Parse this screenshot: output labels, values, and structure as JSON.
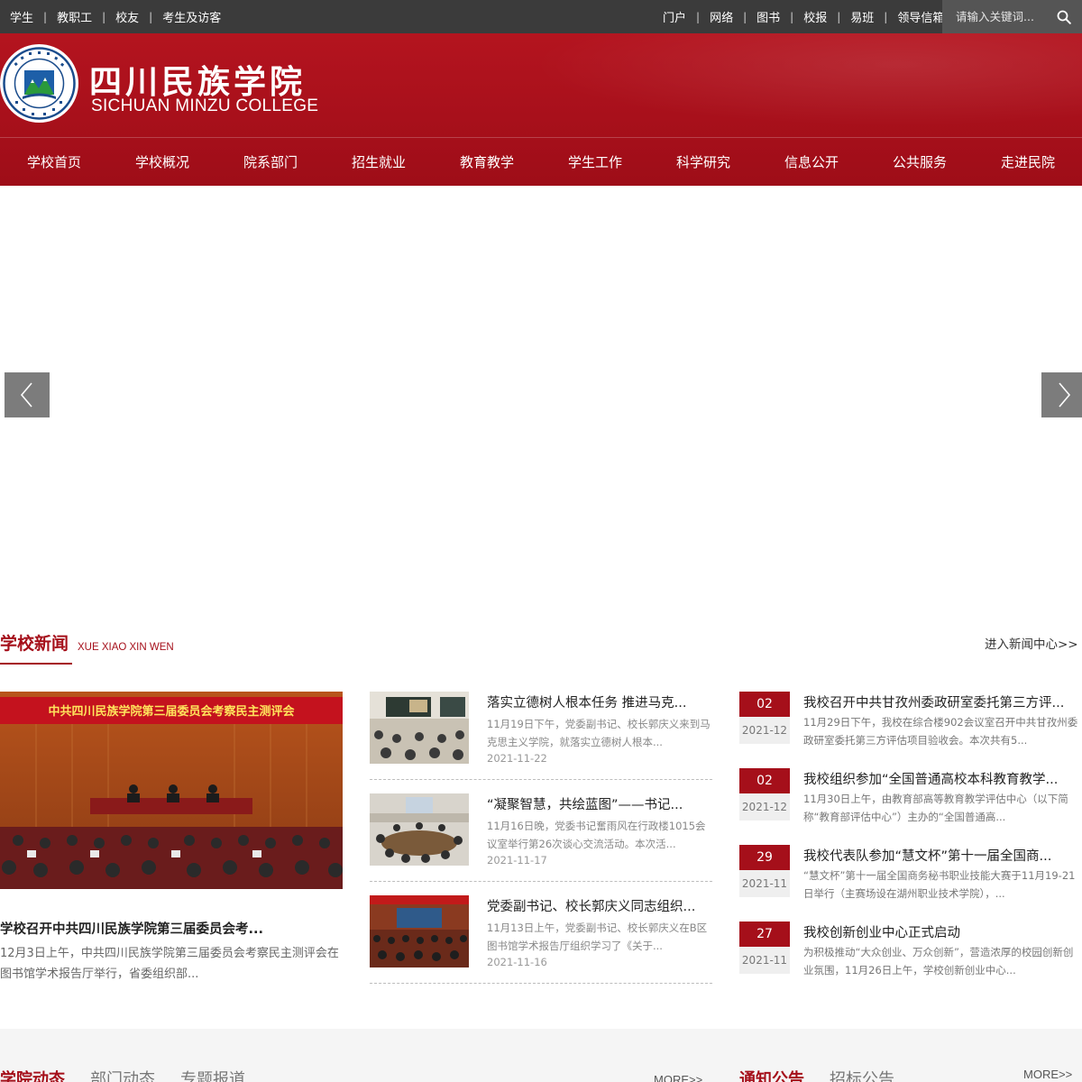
{
  "topbar": {
    "left_links": [
      "学生",
      "教职工",
      "校友",
      "考生及访客"
    ],
    "right_links": [
      "门户",
      "网络",
      "图书",
      "校报",
      "易班",
      "领导信箱"
    ],
    "separator": "|",
    "search_placeholder": "请输入关键词..."
  },
  "header": {
    "title": "四川民族学院",
    "subtitle": "SICHUAN MINZU COLLEGE",
    "brand_color": "#a8101b"
  },
  "nav": [
    "学校首页",
    "学校概况",
    "院系部门",
    "招生就业",
    "教育教学",
    "学生工作",
    "科学研究",
    "信息公开",
    "公共服务",
    "走进民院"
  ],
  "banner": {
    "prev_icon": "chevron-left-icon",
    "next_icon": "chevron-right-icon"
  },
  "news": {
    "title": "学校新闻",
    "subtitle": "XUE XIAO XIN WEN",
    "more": "进入新闻中心>>",
    "feature": {
      "image_caption": "中共四川民族学院第三届委员会考察民主测评会",
      "title": "学校召开中共四川民族学院第三届委员会考...",
      "desc": "12月3日上午，中共四川民族学院第三届委员会考察民主测评会在图书馆学术报告厅举行，省委组织部..."
    },
    "middle": [
      {
        "title": "落实立德树人根本任务 推进马克...",
        "desc": "11月19日下午，党委副书记、校长郭庆义来到马克思主义学院，就落实立德树人根本...",
        "date": "2021-11-22"
      },
      {
        "title": "“凝聚智慧，共绘蓝图”——书记...",
        "desc": "11月16日晚，党委书记奮雨风在行政楼1015会议室举行第26次谈心交流活动。本次活...",
        "date": "2021-11-17"
      },
      {
        "title": "党委副书记、校长郭庆义同志组织...",
        "desc": "11月13日上午，党委副书记、校长郭庆义在B区图书馆学术报告厅组织学习了《关于...",
        "date": "2021-11-16"
      }
    ],
    "right": [
      {
        "day": "02",
        "ym": "2021-12",
        "title": "我校召开中共甘孜州委政研室委托第三方评...",
        "desc": "11月29日下午，我校在综合楼902会议室召开中共甘孜州委政研室委托第三方评估项目验收会。本次共有5..."
      },
      {
        "day": "02",
        "ym": "2021-12",
        "title": "我校组织参加“全国普通高校本科教育教学...",
        "desc": "11月30日上午，由教育部高等教育教学评估中心（以下简称“教育部评估中心”）主办的“全国普通高..."
      },
      {
        "day": "29",
        "ym": "2021-11",
        "title": "我校代表队参加“慧文杯”第十一届全国商...",
        "desc": "“慧文杯”第十一届全国商务秘书职业技能大赛于11月19-21日举行（主赛场设在湖州职业技术学院），..."
      },
      {
        "day": "27",
        "ym": "2021-11",
        "title": "我校创新创业中心正式启动",
        "desc": "为积极推动“大众创业、万众创新”，营造浓厚的校园创新创业氛围，11月26日上午，学校创新创业中心..."
      }
    ]
  },
  "bottom": {
    "left_tabs": [
      "学院动态",
      "部门动态",
      "专题报道"
    ],
    "left_more": "MORE>>",
    "right_tabs": [
      "通知公告",
      "招标公告"
    ],
    "right_more": "MORE>>"
  }
}
